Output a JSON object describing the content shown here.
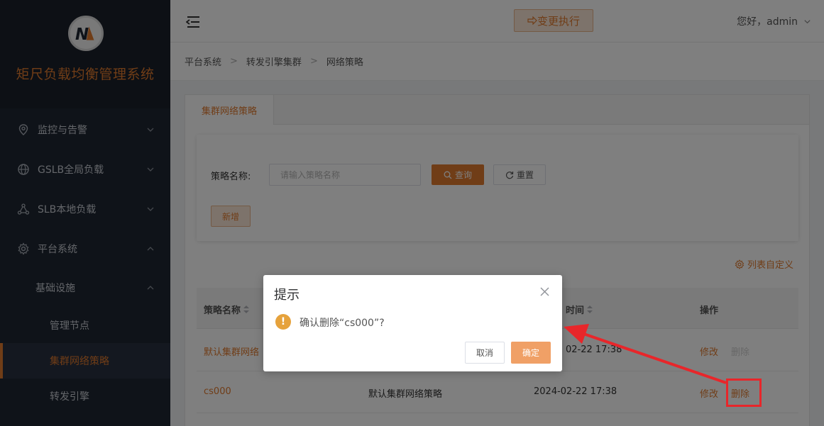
{
  "app": {
    "title": "矩尺负载均衡管理系统",
    "logo_letter": "N"
  },
  "sidebar": {
    "menus": [
      {
        "label": "监控与告警",
        "icon": "location-pin-icon",
        "expanded": false
      },
      {
        "label": "GSLB全局负载",
        "icon": "globe-icon",
        "expanded": false
      },
      {
        "label": "SLB本地负载",
        "icon": "network-nodes-icon",
        "expanded": false
      },
      {
        "label": "平台系统",
        "icon": "gear-icon",
        "expanded": true
      }
    ],
    "submenu_group": "基础设施",
    "submenu_items": [
      "管理节点",
      "集群网络策略",
      "转发引擎"
    ],
    "active_item": "集群网络策略"
  },
  "header": {
    "exec_button": "变更执行",
    "user_greeting": "您好，admin"
  },
  "breadcrumb": [
    "平台系统",
    "转发引擎集群",
    "网络策略"
  ],
  "tabs": [
    {
      "label": "集群网络策略"
    }
  ],
  "search": {
    "label": "策略名称:",
    "placeholder": "请输入策略名称",
    "value": "",
    "query_button": "查询",
    "reset_button": "重置",
    "add_button": "新增"
  },
  "column_custom": "列表自定义",
  "table": {
    "columns": [
      "策略名称",
      "时间",
      "操作"
    ],
    "rows": [
      {
        "name": "默认集群网络",
        "desc": "",
        "time": "02-22 17:38",
        "edit": "修改",
        "delete": "删除",
        "delete_disabled": true
      },
      {
        "name": "cs000",
        "desc": "默认集群网络策略",
        "time": "2024-02-22 17:38",
        "edit": "修改",
        "delete": "删除",
        "delete_disabled": false
      }
    ]
  },
  "dialog": {
    "title": "提示",
    "message": "确认删除“cs000”?",
    "cancel": "取消",
    "confirm": "确定",
    "icon": "warning-icon"
  },
  "colors": {
    "accent": "#e07a2e",
    "sidebar_bg": "#1f2732",
    "annotation": "#e8262a"
  }
}
